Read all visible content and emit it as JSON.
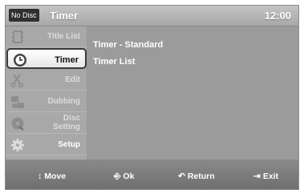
{
  "header": {
    "disc_status": "No Disc",
    "title": "Timer",
    "clock": "12:00"
  },
  "sidebar": {
    "items": [
      {
        "label": "Title List",
        "icon": "film-icon",
        "active": false
      },
      {
        "label": "Timer",
        "icon": "clock-icon",
        "active": true
      },
      {
        "label": "Edit",
        "icon": "scissors-icon",
        "active": false
      },
      {
        "label": "Dubbing",
        "icon": "dubbing-icon",
        "active": false
      },
      {
        "label_line1": "Disc",
        "label_line2": "Setting",
        "icon": "disc-icon",
        "active": false
      },
      {
        "label": "Setup",
        "icon": "gear-icon",
        "active": false
      }
    ]
  },
  "main": {
    "entries": [
      "Timer - Standard",
      "Timer List"
    ]
  },
  "footer": {
    "move": "Move",
    "ok": "Ok",
    "return": "Return",
    "exit": "Exit"
  }
}
